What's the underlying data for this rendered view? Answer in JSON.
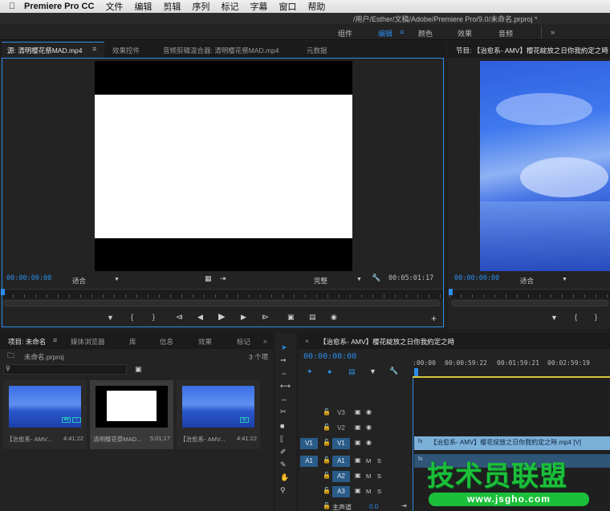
{
  "menubar": {
    "app_name": "Premiere Pro CC",
    "items": [
      "文件",
      "编辑",
      "剪辑",
      "序列",
      "标记",
      "字幕",
      "窗口",
      "帮助"
    ]
  },
  "title_path": "/用户/Esther/文稿/Adobe/Premiere Pro/9.0/未命名.prproj *",
  "workspaces": [
    "组件",
    "编辑",
    "颜色",
    "效果",
    "音频"
  ],
  "workspace_overflow": "»",
  "source_panel": {
    "tabs": [
      "源: 清明樱花祭MAD.mp4",
      "效果控件",
      "音频剪辑混合器: 清明樱花祭MAD.mp4",
      "元数据"
    ],
    "timecode": "00:00:00:00",
    "zoom": "适合",
    "quality": "完整",
    "duration": "00:05:01:17"
  },
  "program_panel": {
    "title": "节目: 【治愈系- AMV】樱花綻放之日你我約定之時",
    "timecode": "00:00:00:00",
    "zoom": "适合"
  },
  "project_panel": {
    "tabs": [
      "项目: 未命名",
      "媒体浏览器",
      "库",
      "信息",
      "效果",
      "标记"
    ],
    "overflow": "»",
    "file": "未命名.prproj",
    "count": "3 个项",
    "items": [
      {
        "name": "【治愈系- AMV...",
        "duration": "4:41:22"
      },
      {
        "name": "清明樱花祭MAD...",
        "duration": "5;01;17"
      },
      {
        "name": "【治愈系- AMV...",
        "duration": "4:41:22"
      }
    ]
  },
  "timeline": {
    "title": "【治愈系- AMV】樱花綻放之日你我約定之時",
    "timecode": "00:00:00:00",
    "ruler": [
      ":00:00",
      "00:00:59:22",
      "00:01:59:21",
      "00:02:59:19"
    ],
    "video_tracks": [
      "V3",
      "V2",
      "V1"
    ],
    "audio_tracks": [
      "A1",
      "A2",
      "A3"
    ],
    "source_v": "V1",
    "source_a": "A1",
    "master": "主声道",
    "master_value": "0.0",
    "m_label": "M",
    "s_label": "S",
    "clip_label": "【治愈系- AMV】樱花綻放之日你我約定之時.mp4 [V]",
    "fx_badge": "fx"
  },
  "watermark": {
    "text": "技术员联盟",
    "url": "www.jsgho.com"
  },
  "colors": {
    "accent": "#2d8ceb",
    "clip": "#7bb0d8",
    "panel": "#232323",
    "watermark": "#1bbf3a"
  }
}
